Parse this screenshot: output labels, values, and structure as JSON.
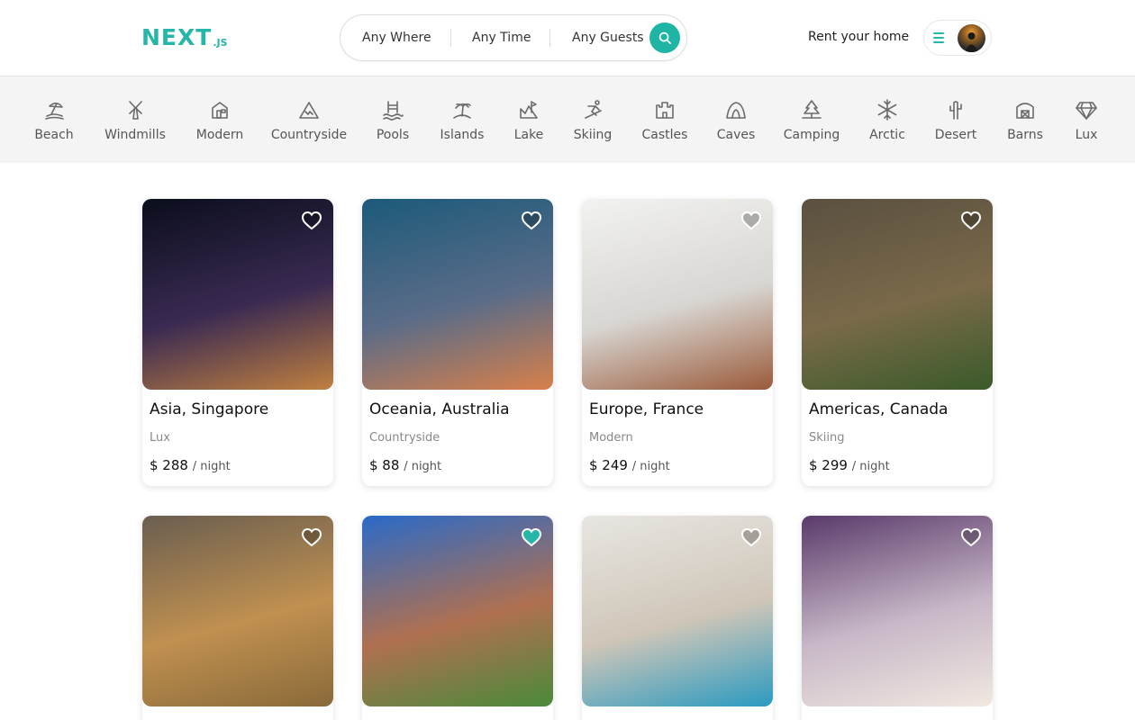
{
  "header": {
    "logo_main": "NEXT",
    "logo_sub": ".JS",
    "search": {
      "where": "Any Where",
      "time": "Any Time",
      "guests": "Any Guests"
    },
    "rent_label": "Rent your home"
  },
  "categories": [
    {
      "label": "Beach",
      "icon": "beach-icon"
    },
    {
      "label": "Windmills",
      "icon": "windmill-icon"
    },
    {
      "label": "Modern",
      "icon": "modern-house-icon"
    },
    {
      "label": "Countryside",
      "icon": "mountain-icon"
    },
    {
      "label": "Pools",
      "icon": "pool-icon"
    },
    {
      "label": "Islands",
      "icon": "island-icon"
    },
    {
      "label": "Lake",
      "icon": "lake-icon"
    },
    {
      "label": "Skiing",
      "icon": "skiing-icon"
    },
    {
      "label": "Castles",
      "icon": "castle-icon"
    },
    {
      "label": "Caves",
      "icon": "cave-icon"
    },
    {
      "label": "Camping",
      "icon": "tree-icon"
    },
    {
      "label": "Arctic",
      "icon": "snowflake-icon"
    },
    {
      "label": "Desert",
      "icon": "cactus-icon"
    },
    {
      "label": "Barns",
      "icon": "barn-icon"
    },
    {
      "label": "Lux",
      "icon": "diamond-icon"
    }
  ],
  "listings": [
    {
      "title": "Asia, Singapore",
      "category": "Lux",
      "price": "$ 288",
      "unit": "/ night",
      "favorite": false,
      "colors": [
        "#0a0e1c",
        "#3a2a52",
        "#c08040"
      ]
    },
    {
      "title": "Oceania, Australia",
      "category": "Countryside",
      "price": "$ 88",
      "unit": "/ night",
      "favorite": false,
      "colors": [
        "#1c5a7a",
        "#5a6c88",
        "#d8804a"
      ]
    },
    {
      "title": "Europe, France",
      "category": "Modern",
      "price": "$ 249",
      "unit": "/ night",
      "favorite": false,
      "colors": [
        "#f2f2f0",
        "#d8d6d2",
        "#9a5a3a"
      ]
    },
    {
      "title": "Americas, Canada",
      "category": "Skiing",
      "price": "$ 299",
      "unit": "/ night",
      "favorite": false,
      "colors": [
        "#5a5040",
        "#7a6a4a",
        "#3a5a2a"
      ]
    },
    {
      "title": "",
      "category": "",
      "price": "",
      "unit": "",
      "favorite": false,
      "colors": [
        "#6a5e50",
        "#c09050",
        "#8a6a3a"
      ]
    },
    {
      "title": "",
      "category": "",
      "price": "",
      "unit": "",
      "favorite": true,
      "colors": [
        "#2a6ac8",
        "#b07050",
        "#4a8a3a"
      ]
    },
    {
      "title": "",
      "category": "",
      "price": "",
      "unit": "",
      "favorite": false,
      "colors": [
        "#e8e6e2",
        "#cfc6b8",
        "#2a9ac0"
      ]
    },
    {
      "title": "",
      "category": "",
      "price": "",
      "unit": "",
      "favorite": false,
      "colors": [
        "#5a3a6a",
        "#c8b8c8",
        "#f0e8e0"
      ]
    }
  ],
  "colors": {
    "accent": "#24b6a8",
    "favorite": "#24b6a8"
  }
}
